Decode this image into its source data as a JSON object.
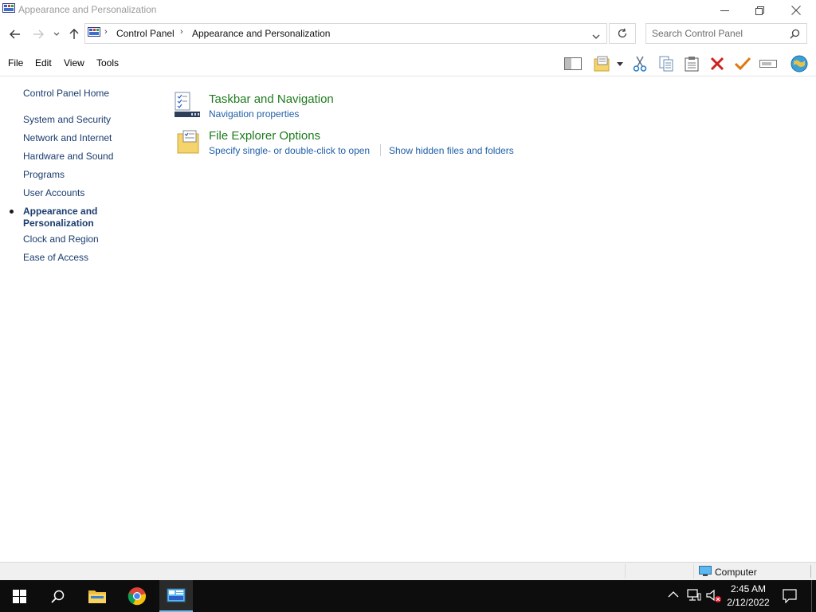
{
  "window": {
    "title": "Appearance and Personalization"
  },
  "address": {
    "crumbs": [
      "Control Panel",
      "Appearance and Personalization"
    ],
    "search_placeholder": "Search Control Panel"
  },
  "menu": {
    "file": "File",
    "edit": "Edit",
    "view": "View",
    "tools": "Tools"
  },
  "sidebar": {
    "items": [
      {
        "label": "Control Panel Home"
      },
      {
        "label": "System and Security"
      },
      {
        "label": "Network and Internet"
      },
      {
        "label": "Hardware and Sound"
      },
      {
        "label": "Programs"
      },
      {
        "label": "User Accounts"
      },
      {
        "label": "Appearance and Personalization",
        "selected": true
      },
      {
        "label": "Clock and Region"
      },
      {
        "label": "Ease of Access"
      }
    ]
  },
  "categories": [
    {
      "title": "Taskbar and Navigation",
      "links": [
        "Navigation properties"
      ]
    },
    {
      "title": "File Explorer Options",
      "links": [
        "Specify single- or double-click to open",
        "Show hidden files and folders"
      ]
    }
  ],
  "statusbar": {
    "location": "Computer"
  },
  "taskbar": {
    "time": "2:45 AM",
    "date": "2/12/2022"
  },
  "colors": {
    "category_title": "#1e7b1e",
    "link": "#1f5fa8",
    "taskbar": "#0d0d0d"
  }
}
